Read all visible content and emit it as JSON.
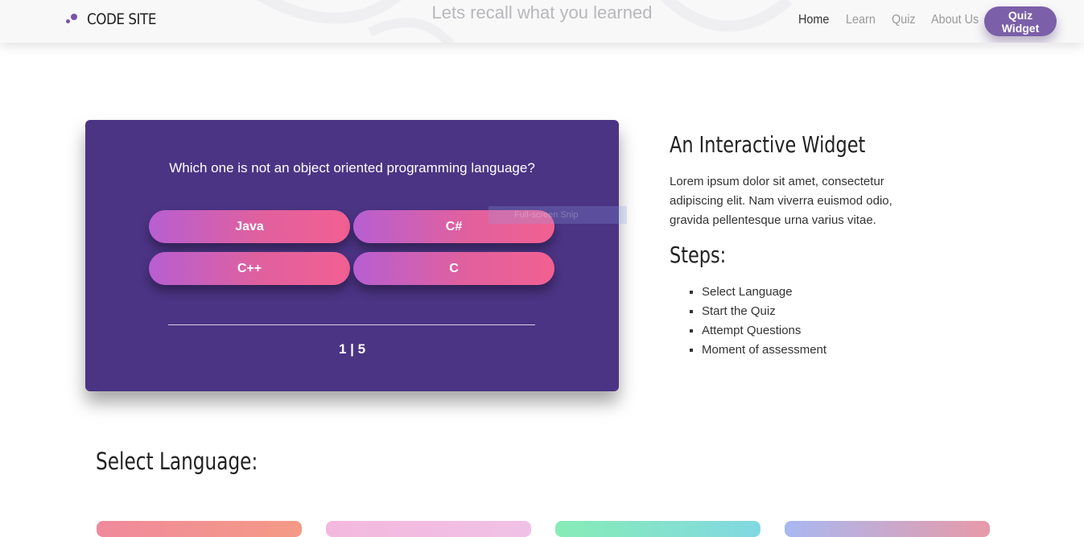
{
  "header": {
    "brand": "CODE SITE",
    "tagline": "Lets recall what you learned",
    "nav": [
      {
        "label": "Home",
        "active": true
      },
      {
        "label": "Learn",
        "active": false
      },
      {
        "label": "Quiz",
        "active": false
      },
      {
        "label": "About Us",
        "active": false
      }
    ],
    "cta_label": "Quiz Widget",
    "logo_icon": "dots-logo-icon"
  },
  "quiz": {
    "question": "Which one is not an object oriented programming language?",
    "options": [
      "Java",
      "C#",
      "C++",
      "C"
    ],
    "progress": "1 | 5"
  },
  "overlay": {
    "snip_label": "Full-screen Snip"
  },
  "info": {
    "title": "An Interactive Widget",
    "text": "Lorem ipsum dolor sit amet, consectetur adipiscing elit. Nam viverra euismod odio, gravida pellentesque urna varius vitae.",
    "steps_title": "Steps:",
    "steps": [
      "Select Language",
      "Start the Quiz",
      "Attempt Questions",
      "Moment of assessment"
    ]
  },
  "languages": {
    "title": "Select Language:"
  },
  "colors": {
    "card_bg": "#4b3484",
    "accent": "#7b5fa8",
    "option_gradient_start": "#b75fd2",
    "option_gradient_end": "#f26092"
  }
}
